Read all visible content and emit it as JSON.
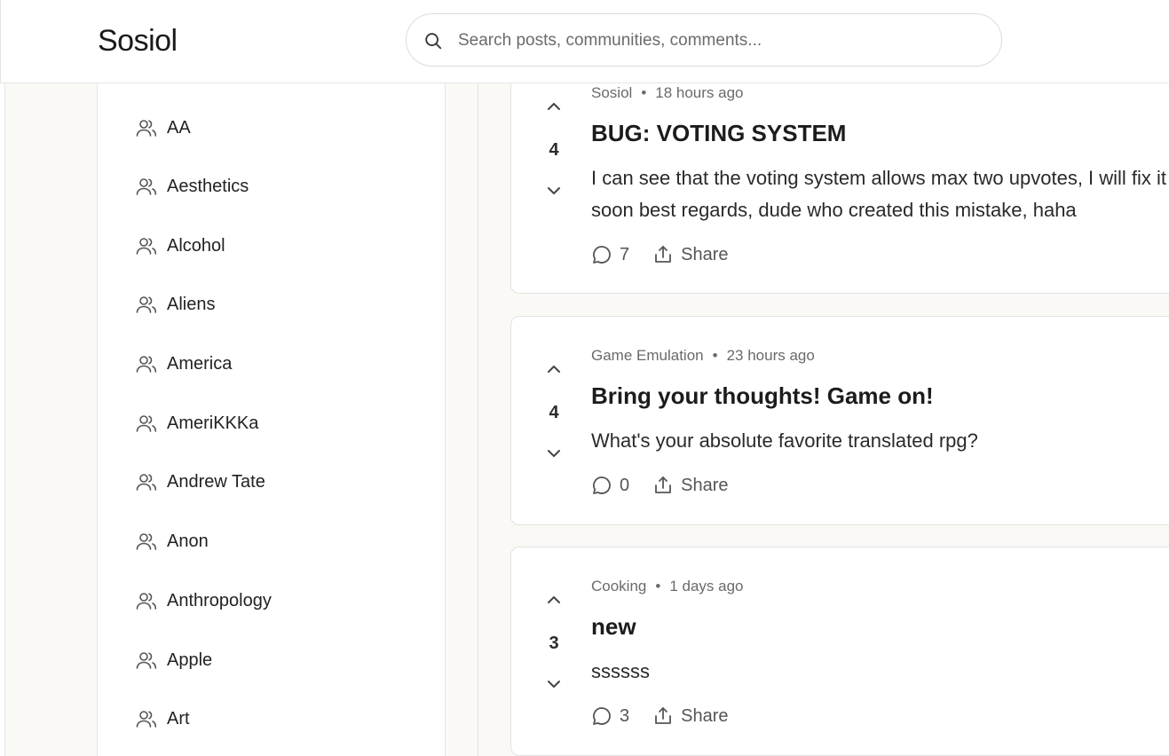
{
  "header": {
    "logo": "Sosiol",
    "search_placeholder": "Search posts, communities, comments..."
  },
  "sidebar": {
    "communities": [
      {
        "label": "AA"
      },
      {
        "label": "Aesthetics"
      },
      {
        "label": "Alcohol"
      },
      {
        "label": "Aliens"
      },
      {
        "label": "America"
      },
      {
        "label": "AmeriKKKa"
      },
      {
        "label": "Andrew Tate"
      },
      {
        "label": "Anon"
      },
      {
        "label": "Anthropology"
      },
      {
        "label": "Apple"
      },
      {
        "label": "Art"
      }
    ]
  },
  "posts": [
    {
      "community": "Sosiol",
      "time": "18 hours ago",
      "votes": "4",
      "title": "BUG: VOTING SYSTEM",
      "body": "I can see that the voting system allows max two upvotes, I will fix it soon best regards, dude who created this mistake, haha",
      "comments": "7",
      "share_label": "Share"
    },
    {
      "community": "Game Emulation",
      "time": "23 hours ago",
      "votes": "4",
      "title": "Bring your thoughts! Game on!",
      "body": "What's your absolute favorite translated rpg?",
      "comments": "0",
      "share_label": "Share"
    },
    {
      "community": "Cooking",
      "time": "1 days ago",
      "votes": "3",
      "title": "new",
      "body": "ssssss",
      "comments": "3",
      "share_label": "Share"
    }
  ],
  "icons": {
    "search": "search-icon",
    "community": "users-icon",
    "upvote": "chevron-up-icon",
    "downvote": "chevron-down-icon",
    "comment": "comment-icon",
    "share": "share-icon"
  }
}
